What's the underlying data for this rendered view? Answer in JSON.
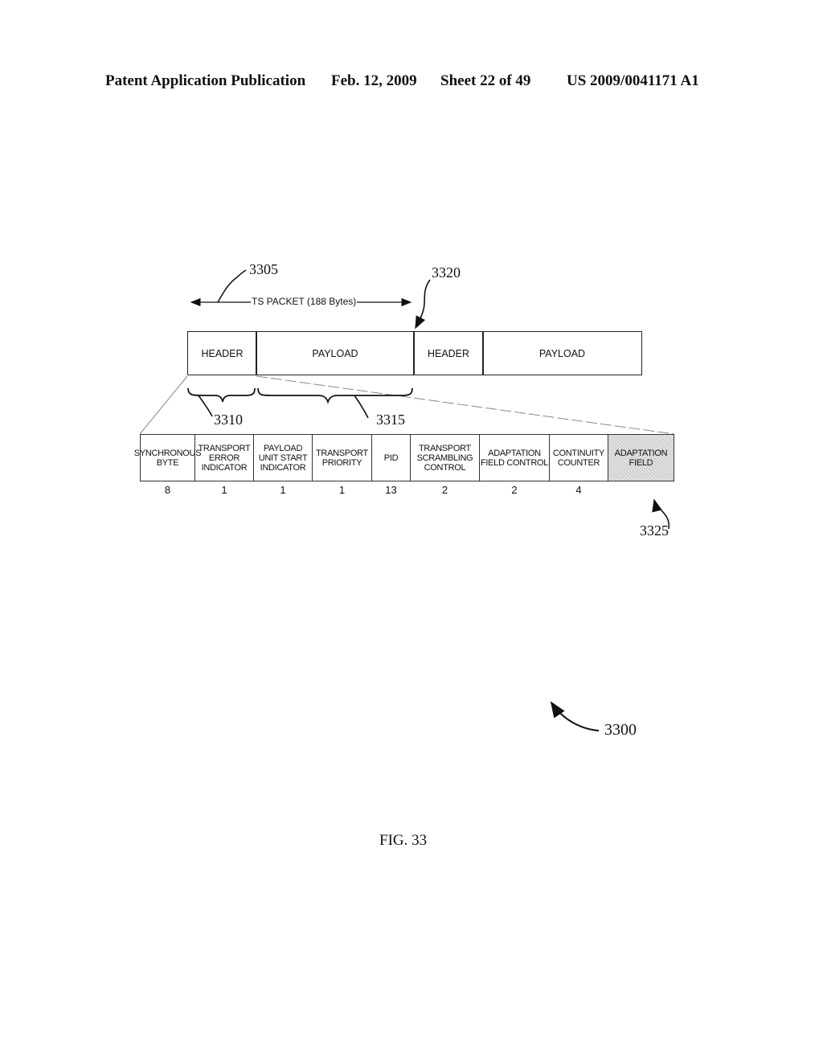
{
  "header": {
    "publication": "Patent Application Publication",
    "date": "Feb. 12, 2009",
    "sheet": "Sheet 22 of 49",
    "number": "US 2009/0041171 A1"
  },
  "diagram": {
    "ts_packet_label": "TS PACKET (188 Bytes)",
    "packets": [
      {
        "header": "HEADER",
        "payload": "PAYLOAD"
      },
      {
        "header": "HEADER",
        "payload": "PAYLOAD"
      }
    ],
    "fields": [
      {
        "label": "SYNCHRONOUS BYTE",
        "bits": "8"
      },
      {
        "label": "TRANSPORT ERROR INDICATOR",
        "bits": "1"
      },
      {
        "label": "PAYLOAD UNIT START INDICATOR",
        "bits": "1"
      },
      {
        "label": "TRANSPORT PRIORITY",
        "bits": "1"
      },
      {
        "label": "PID",
        "bits": "13"
      },
      {
        "label": "TRANSPORT SCRAMBLING CONTROL",
        "bits": "2"
      },
      {
        "label": "ADAPTATION FIELD CONTROL",
        "bits": "2"
      },
      {
        "label": "CONTINUITY COUNTER",
        "bits": "4"
      },
      {
        "label": "ADAPTATION FIELD",
        "bits": ""
      }
    ],
    "refs": {
      "r3305": "3305",
      "r3320": "3320",
      "r3310": "3310",
      "r3315": "3315",
      "r3325": "3325",
      "r3300": "3300"
    },
    "caption": "FIG. 33"
  }
}
